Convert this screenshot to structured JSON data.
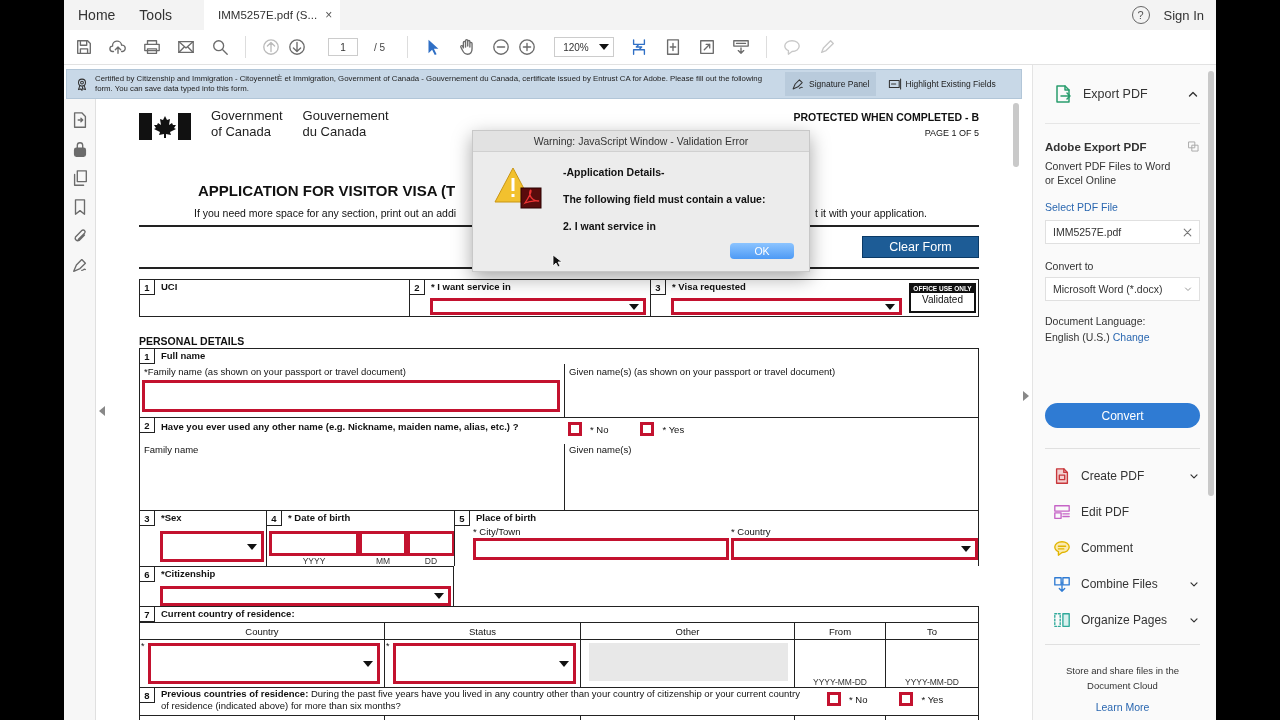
{
  "top_bar": {
    "nav": [
      "Home",
      "Tools"
    ],
    "tab": {
      "title": "IMM5257E.pdf (S...",
      "close": "×"
    },
    "help": "?",
    "sign_in": "Sign In"
  },
  "toolbar": {
    "page": "1",
    "page_total": "/ 5",
    "zoom": "120%"
  },
  "notice": {
    "text": "Certified by Citizenship and Immigration - CitoyennetÈ et Immigration, Government of Canada - Gouvernement du Canada, certificate issued by Entrust CA for Adobe.  Please fill out the following form. You can save data typed into this form.",
    "buttons": [
      "Signature Panel",
      "Highlight Existing Fields"
    ]
  },
  "form": {
    "header": {
      "gov_en": [
        "Government",
        "of Canada"
      ],
      "gov_fr": [
        "Gouvernement",
        "du Canada"
      ],
      "protected": "PROTECTED WHEN COMPLETED - B",
      "page": "PAGE 1 OF 5"
    },
    "title": "APPLICATION FOR VISITOR VISA (T",
    "instruction": [
      "If you need more space for any section, print out an addi",
      "t it with your application."
    ],
    "clear_button": "Clear Form",
    "row1": [
      {
        "number": "1",
        "label": "UCI"
      },
      {
        "number": "2",
        "label": "* I want service in",
        "field": {
          "kind": "dropdown",
          "required": true
        }
      },
      {
        "number": "3",
        "label": "* Visa requested",
        "field": {
          "kind": "dropdown",
          "required": true
        }
      }
    ],
    "office": {
      "header": "OFFICE USE ONLY",
      "value": "Validated"
    },
    "section_title": "PERSONAL DETAILS",
    "q1": {
      "number": "1",
      "label": "Full name",
      "family": {
        "label": "*Family name (as shown on your passport or travel document)",
        "field": {
          "kind": "text",
          "required": true
        }
      },
      "given": {
        "label": "Given name(s) (as shown on your passport or travel document)"
      }
    },
    "q2": {
      "number": "2",
      "label": "Have you ever used any other name (e.g. Nickname, maiden name, alias, etc.) ?",
      "options": [
        {
          "label": "* No",
          "checked": false
        },
        {
          "label": "* Yes",
          "checked": false
        }
      ],
      "family": {
        "label": "Family name"
      },
      "given": {
        "label": "Given name(s)"
      }
    },
    "q3": {
      "number": "3",
      "label": "*Sex",
      "field": {
        "kind": "dropdown",
        "required": true
      }
    },
    "q4": {
      "number": "4",
      "label": "* Date of birth",
      "parts": [
        {
          "caption": "YYYY",
          "required": true
        },
        {
          "caption": "MM",
          "required": true
        },
        {
          "caption": "DD",
          "required": true
        }
      ]
    },
    "q5": {
      "number": "5",
      "label": "Place of birth",
      "fields": [
        {
          "label": "* City/Town",
          "kind": "text",
          "required": true
        },
        {
          "label": "* Country",
          "kind": "dropdown",
          "required": true
        }
      ]
    },
    "q6": {
      "number": "6",
      "label": "*Citizenship",
      "field": {
        "kind": "dropdown",
        "required": true
      }
    },
    "q7": {
      "number": "7",
      "label": "Current country of residence:",
      "columns": [
        "Country",
        "Status",
        "Other",
        "From",
        "To"
      ],
      "cells": [
        {
          "kind": "dropdown",
          "required": true,
          "mark": "*"
        },
        {
          "kind": "dropdown",
          "required": true,
          "mark": "*"
        },
        {
          "kind": "text",
          "disabled": true
        },
        {
          "kind": "date",
          "caption": "YYYY-MM-DD"
        },
        {
          "kind": "date",
          "caption": "YYYY-MM-DD"
        }
      ]
    },
    "q8": {
      "number": "8",
      "text": "**Previous countries of residence:** During the past five years have you lived in any country other than your country of citizenship or your current country of residence (indicated above) for more than six months?",
      "options": [
        {
          "label": "* No",
          "checked": false
        },
        {
          "label": "* Yes",
          "checked": false
        }
      ]
    }
  },
  "dialog": {
    "title": "Warning: JavaScript Window - Validation Error",
    "lines": [
      "-Application Details-",
      "The following field must contain a value:",
      "2. I want service in"
    ],
    "button": "OK"
  },
  "right_panel": {
    "header": "Export PDF",
    "expanded": true,
    "title": "Adobe Export PDF",
    "description": "Convert PDF Files to Word or Excel Online",
    "select_link": "Select PDF File",
    "file": "IMM5257E.pdf",
    "convert_to_label": "Convert to",
    "format": "Microsoft Word (*.docx)",
    "language_label": "Document Language:",
    "language": "English (U.S.)",
    "change_link": "Change",
    "convert_button": "Convert",
    "tools": [
      {
        "kind": "create",
        "label": "Create PDF",
        "has_menu": true
      },
      {
        "kind": "edit",
        "label": "Edit PDF",
        "has_menu": false
      },
      {
        "kind": "comment",
        "label": "Comment",
        "has_menu": false
      },
      {
        "kind": "combine",
        "label": "Combine Files",
        "has_menu": true
      },
      {
        "kind": "organize",
        "label": "Organize Pages",
        "has_menu": true
      }
    ],
    "footer": "Store and share files in the Document Cloud",
    "footer_link": "Learn More"
  }
}
